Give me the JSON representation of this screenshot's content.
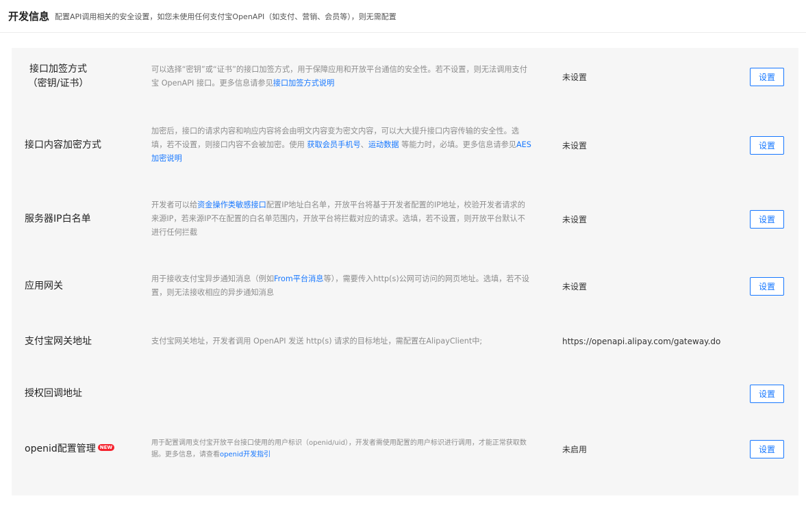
{
  "header": {
    "title": "开发信息",
    "subtitle": "配置API调用相关的安全设置，如您未使用任何支付宝OpenAPI（如支付、营销、会员等），则无需配置"
  },
  "rows": [
    {
      "name_line1": "接口加签方式",
      "name_line2": "（密钥/证书）",
      "desc_a": "可以选择“密钥”或“证书”的接口加签方式，用于保障应用和开放平台通信的安全性。若不设置，则无法调用支付宝 OpenAPI 接口。更多信息请参见",
      "desc_link": "接口加签方式说明",
      "status": "未设置",
      "button": "设置"
    },
    {
      "name": "接口内容加密方式",
      "desc_a": "加密后，接口的请求内容和响应内容将会由明文内容变为密文内容，可以大大提升接口内容传输的安全性。选填，若不设置，则接口内容不会被加密。使用 ",
      "desc_link1": "获取会员手机号",
      "desc_sep": "、",
      "desc_link2": "运动数据",
      "desc_b": " 等能力时，必填。更多信息请参见",
      "desc_link3": "AES加密说明",
      "status": "未设置",
      "button": "设置"
    },
    {
      "name": "服务器IP白名单",
      "desc_a": "开发者可以给",
      "desc_link": "资金操作类敏感接口",
      "desc_b": "配置IP地址白名单，开放平台将基于开发者配置的IP地址，校验开发者请求的来源IP，若来源IP不在配置的白名单范围内，开放平台将拦截对应的请求。选填，若不设置，则开放平台默认不进行任何拦截",
      "status": "未设置",
      "button": "设置"
    },
    {
      "name": "应用网关",
      "desc_a": "用于接收支付宝异步通知消息（例如",
      "desc_link": "From平台消息",
      "desc_b": "等），需要传入http(s)公网可访问的网页地址。选填，若不设置，则无法接收相应的异步通知消息",
      "status": "未设置",
      "button": "设置"
    },
    {
      "name": "支付宝网关地址",
      "desc": "支付宝网关地址，开发者调用 OpenAPI 发送 http(s) 请求的目标地址，需配置在AlipayClient中;",
      "status": "https://openapi.alipay.com/gateway.do"
    },
    {
      "name": "授权回调地址",
      "button": "设置"
    },
    {
      "name": "openid配置管理",
      "badge": "NEW",
      "desc_a": "用于配置调用支付宝开放平台接口使用的用户标识（openid/uid），开发者需使用配置的用户标识进行调用，才能正常获取数据。更多信息，请查看",
      "desc_link": "openid开发指引",
      "status": "未启用",
      "button": "设置"
    }
  ]
}
